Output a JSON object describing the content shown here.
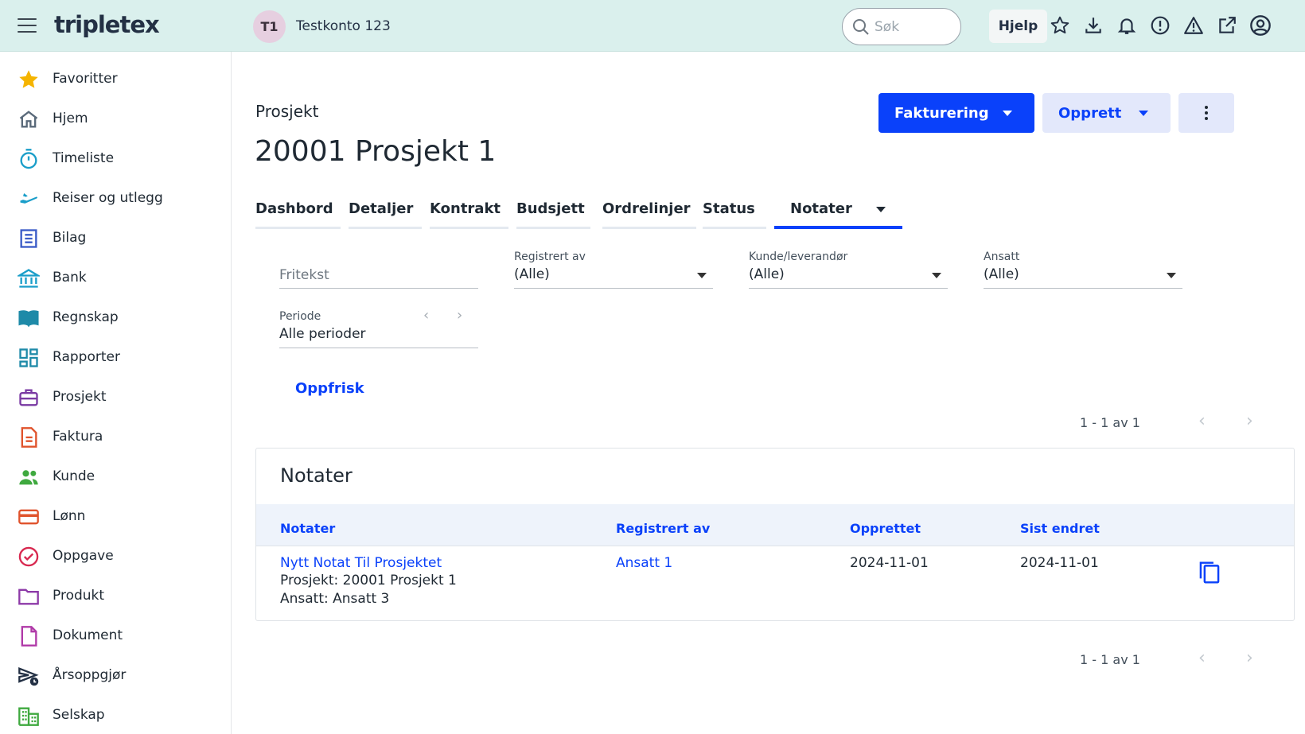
{
  "topbar": {
    "logo": "tripletex",
    "company_initials": "T1",
    "company_name": "Testkonto 123",
    "search_placeholder": "Søk",
    "help_label": "Hjelp",
    "icons": [
      "star-icon",
      "download-icon",
      "bell-icon",
      "alert-circle-icon",
      "warning-icon",
      "external-link-icon",
      "user-circle-icon"
    ]
  },
  "sidebar": {
    "items": [
      {
        "label": "Favoritter",
        "icon": "star-icon"
      },
      {
        "label": "Hjem",
        "icon": "home-icon"
      },
      {
        "label": "Timeliste",
        "icon": "stopwatch-icon"
      },
      {
        "label": "Reiser og utlegg",
        "icon": "airplane-icon"
      },
      {
        "label": "Bilag",
        "icon": "receipt-icon"
      },
      {
        "label": "Bank",
        "icon": "bank-icon"
      },
      {
        "label": "Regnskap",
        "icon": "book-icon"
      },
      {
        "label": "Rapporter",
        "icon": "dashboard-icon"
      },
      {
        "label": "Prosjekt",
        "icon": "briefcase-icon"
      },
      {
        "label": "Faktura",
        "icon": "invoice-icon"
      },
      {
        "label": "Kunde",
        "icon": "people-icon"
      },
      {
        "label": "Lønn",
        "icon": "card-icon"
      },
      {
        "label": "Oppgave",
        "icon": "check-circle-icon"
      },
      {
        "label": "Produkt",
        "icon": "folder-icon"
      },
      {
        "label": "Dokument",
        "icon": "document-icon"
      },
      {
        "label": "Årsoppgjør",
        "icon": "year-end-icon"
      },
      {
        "label": "Selskap",
        "icon": "building-icon"
      }
    ]
  },
  "page": {
    "breadcrumb": "Prosjekt",
    "title": "20001 Prosjekt 1",
    "fakturering_label": "Fakturering",
    "opprett_label": "Opprett"
  },
  "tabs": [
    "Dashbord",
    "Detaljer",
    "Kontrakt",
    "Budsjett",
    "Ordrelinjer",
    "Status",
    "Notater"
  ],
  "active_tab": "Notater",
  "filters": {
    "fritekst_placeholder": "Fritekst",
    "registrert_av": {
      "label": "Registrert av",
      "value": "(Alle)"
    },
    "kunde": {
      "label": "Kunde/leverandør",
      "value": "(Alle)"
    },
    "ansatt": {
      "label": "Ansatt",
      "value": "(Alle)"
    },
    "periode": {
      "label": "Periode",
      "value": "Alle perioder"
    },
    "refresh_label": "Oppfrisk"
  },
  "pager_text": "1 - 1 av 1",
  "notes_table": {
    "title": "Notater",
    "columns": [
      "Notater",
      "Registrert av",
      "Opprettet",
      "Sist endret"
    ],
    "rows": [
      {
        "note_title": "Nytt Notat Til Prosjektet",
        "note_project": "Prosjekt: 20001 Prosjekt 1",
        "note_employee": "Ansatt: Ansatt 3",
        "registered_by": "Ansatt 1",
        "created": "2024-11-01",
        "modified": "2024-11-01"
      }
    ]
  },
  "colors": {
    "topbar_bg": "#daf0ed",
    "primary": "#0a41fa",
    "secondary_bg": "#e3e8fb"
  }
}
